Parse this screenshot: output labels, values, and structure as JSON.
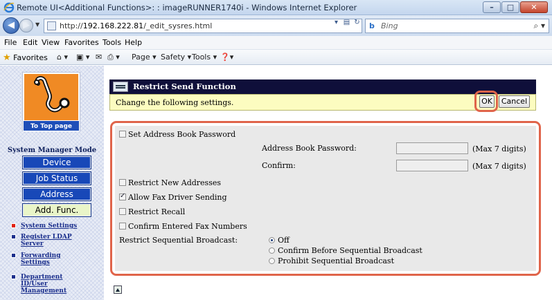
{
  "window": {
    "title": "Remote UI<Additional Functions>: : imageRUNNER1740i - Windows Internet Explorer",
    "minimize": "–",
    "maximize": "□",
    "close": "✕"
  },
  "address_bar": {
    "url_prefix": "http://",
    "url_host": "192.168.222.81",
    "url_path": "/_edit_sysres.html",
    "search_placeholder": "Bing"
  },
  "menu": [
    "File",
    "Edit",
    "View",
    "Favorites",
    "Tools",
    "Help"
  ],
  "favorites_bar": {
    "favorites": "Favorites",
    "page": "Page ▾",
    "safety": "Safety ▾",
    "tools": "Tools ▾"
  },
  "sidebar": {
    "to_top_page": "To Top page",
    "mode_label": "System Manager Mode",
    "nav": [
      {
        "label": "Device",
        "active": false
      },
      {
        "label": "Job Status",
        "active": false
      },
      {
        "label": "Address",
        "active": false
      },
      {
        "label": "Add. Func.",
        "active": true
      }
    ],
    "links": [
      {
        "label": "System Settings",
        "current": true
      },
      {
        "label": "Register LDAP Server",
        "current": false
      },
      {
        "label": "Forwarding Settings",
        "current": false
      },
      {
        "label": "Department ID/User Management",
        "current": false
      }
    ]
  },
  "main": {
    "header_title": "Restrict Send Function",
    "notice": "Change the following settings.",
    "ok_label": "OK",
    "cancel_label": "Cancel"
  },
  "settings": {
    "address_book_password": {
      "label": "Set Address Book Password",
      "checked": false
    },
    "password_label": "Address Book Password:",
    "confirm_label": "Confirm:",
    "max_hint": "(Max 7 digits)",
    "restrict_new_addresses": {
      "label": "Restrict New Addresses",
      "checked": false
    },
    "allow_fax_driver": {
      "label": "Allow Fax Driver Sending",
      "checked": true
    },
    "restrict_recall": {
      "label": "Restrict Recall",
      "checked": false
    },
    "confirm_fax_numbers": {
      "label": "Confirm Entered Fax Numbers",
      "checked": false
    },
    "sequential_broadcast_label": "Restrict Sequential Broadcast:",
    "sequential_broadcast_options": [
      {
        "label": "Off",
        "selected": true
      },
      {
        "label": "Confirm Before Sequential Broadcast",
        "selected": false
      },
      {
        "label": "Prohibit Sequential Broadcast",
        "selected": false
      }
    ]
  },
  "colors": {
    "highlight": "#e0644a",
    "header_bg": "#0f0f3a",
    "notice_bg": "#fcfcc0",
    "nav_blue": "#1848b8"
  }
}
